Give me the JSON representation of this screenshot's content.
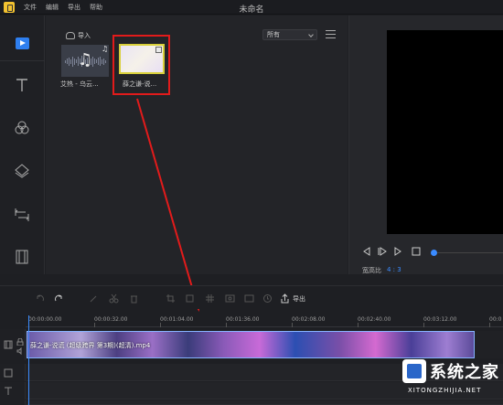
{
  "menu": [
    "文件",
    "编辑",
    "导出",
    "帮助"
  ],
  "window_title": "未命名",
  "media": {
    "import_label": "导入",
    "filter_value": "所有",
    "items": [
      {
        "label": "艾热 - 乌云...",
        "type": "audio"
      },
      {
        "label": "薛之谦-说...",
        "type": "video"
      }
    ]
  },
  "preview": {
    "ratio_label": "宽高比",
    "ratio_value": "4 : 3"
  },
  "toolbar": {
    "export_label": "导出"
  },
  "ruler": [
    "00:00:00.00",
    "00:00:32.00",
    "00:01:04.00",
    "00:01:36.00",
    "00:02:08.00",
    "00:02:40.00",
    "00:03:12.00",
    "00:0"
  ],
  "clip": {
    "label": "薛之谦-说谎 (超级跨界 第3期)(超清).mp4"
  },
  "watermark": {
    "text": "系统之家",
    "url": "XITONGZHIJIA.NET"
  },
  "colors": {
    "accent": "#3a8bff",
    "highlight": "#e21b1b",
    "arrow": "#e21b1b"
  }
}
